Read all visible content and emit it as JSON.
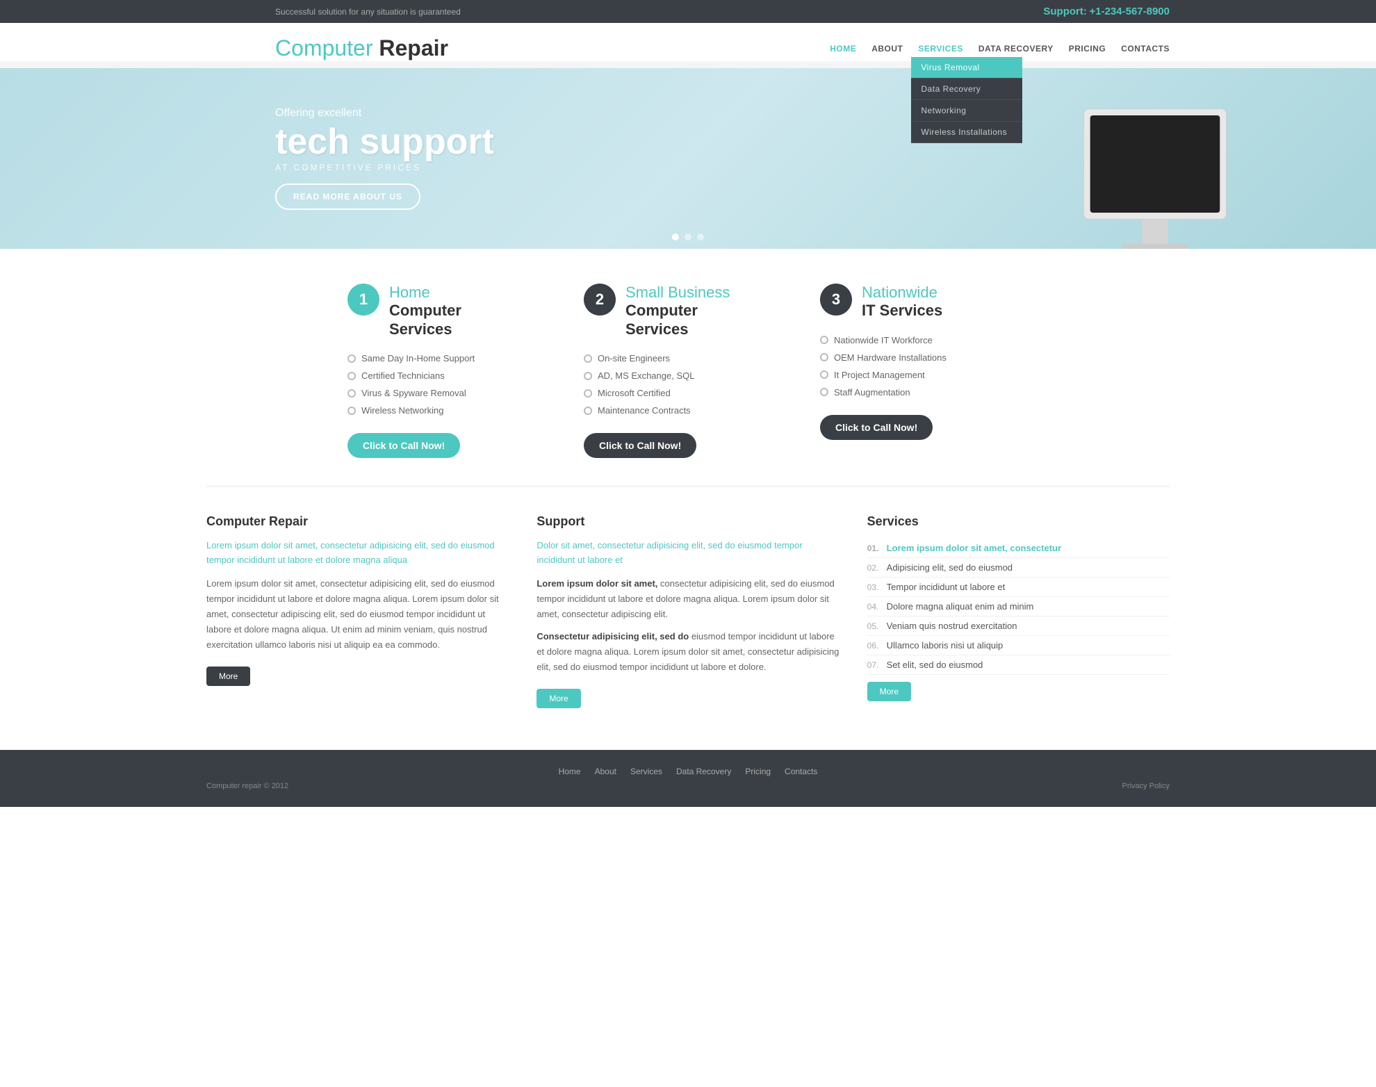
{
  "topbar": {
    "tagline": "Successful solution for any situation is guaranteed",
    "support_label": "Support:",
    "phone": "+1-234-567-8900"
  },
  "header": {
    "logo_light": "Computer ",
    "logo_bold": "Repair",
    "nav": {
      "home": "HOME",
      "about": "ABOUT",
      "services": "SERVICES",
      "data_recovery": "DATA RECOVERY",
      "pricing": "PRICING",
      "contacts": "CONTACTS"
    },
    "dropdown": {
      "virus_removal": "Virus Removal",
      "data_recovery": "Data Recovery",
      "networking": "Networking",
      "wireless": "Wireless Installations"
    }
  },
  "hero": {
    "subtitle": "Offering excellent",
    "main_title": "tech support",
    "tagline": "AT COMPETITIVE PRICES",
    "button": "READ MORE ABOUT US"
  },
  "services": [
    {
      "number": "1",
      "title_teal": "Home",
      "title_dark": "Computer\nServices",
      "items": [
        "Same Day In-Home Support",
        "Certified Technicians",
        "Virus & Spyware Removal",
        "Wireless Networking"
      ],
      "btn_label": "Click to Call Now!",
      "btn_style": "teal"
    },
    {
      "number": "2",
      "title_teal": "Small Business",
      "title_dark": "Computer\nServices",
      "items": [
        "On-site Engineers",
        "AD, MS Exchange, SQL",
        "Microsoft Certified",
        "Maintenance Contracts"
      ],
      "btn_label": "Click to Call Now!",
      "btn_style": "dark"
    },
    {
      "number": "3",
      "title_teal": "Nationwide",
      "title_dark": "IT Services",
      "items": [
        "Nationwide IT Workforce",
        "OEM Hardware Installations",
        "It Project Management",
        "Staff Augmentation"
      ],
      "btn_label": "Click to Call Now!",
      "btn_style": "dark"
    }
  ],
  "info": {
    "computer_repair": {
      "heading": "Computer Repair",
      "highlight": "Lorem ipsum dolor sit amet, consectetur adipisicing elit, sed do eiusmod tempor incididunt ut labore et dolore magna aliqua",
      "body": "Lorem ipsum dolor sit amet, consectetur adipisicing elit, sed do eiusmod tempor incididunt ut labore et dolore magna aliqua. Lorem ipsum dolor sit amet, consectetur adipiscing elit, sed do eiusmod tempor incididunt ut labore et dolore magna aliqua. Ut enim ad minim veniam, quis nostrud exercitation ullamco laboris nisi ut aliquip ea ea commodo.",
      "btn": "More"
    },
    "support": {
      "heading": "Support",
      "highlight": "Dolor sit amet, consectetur adipisicing elit, sed do eiusmod tempor incididunt ut labore et",
      "body1_bold": "Lorem ipsum dolor sit amet,",
      "body1": " consectetur adipisicing elit, sed do eiusmod tempor incididunt ut labore et dolore magna aliqua. Lorem ipsum dolor sit amet, consectetur adipiscing elit.",
      "body2_bold": "Consectetur adipisicing elit, sed do",
      "body2": " eiusmod tempor incididunt ut labore et dolore magna aliqua. Lorem ipsum dolor sit amet, consectetur adipisicing elit, sed do eiusmod tempor incididunt ut labore et dolore.",
      "btn": "More"
    },
    "services": {
      "heading": "Services",
      "items": [
        {
          "num": "01.",
          "text": "Lorem ipsum dolor sit amet, consectetur",
          "highlight": true
        },
        {
          "num": "02.",
          "text": "Adipisicing elit, sed do eiusmod",
          "highlight": false
        },
        {
          "num": "03.",
          "text": "Tempor incididunt ut labore et",
          "highlight": false
        },
        {
          "num": "04.",
          "text": "Dolore magna aliquat enim ad minim",
          "highlight": false
        },
        {
          "num": "05.",
          "text": "Veniam quis nostrud exercitation",
          "highlight": false
        },
        {
          "num": "06.",
          "text": "Ullamco laboris nisi ut aliquip",
          "highlight": false
        },
        {
          "num": "07.",
          "text": "Set elit, sed do eiusmod",
          "highlight": false
        }
      ],
      "btn": "More"
    }
  },
  "footer": {
    "links": [
      "Home",
      "About",
      "Services",
      "Data Recovery",
      "Pricing",
      "Contacts"
    ],
    "copyright": "Computer repair © 2012",
    "privacy": "Privacy Policy"
  }
}
